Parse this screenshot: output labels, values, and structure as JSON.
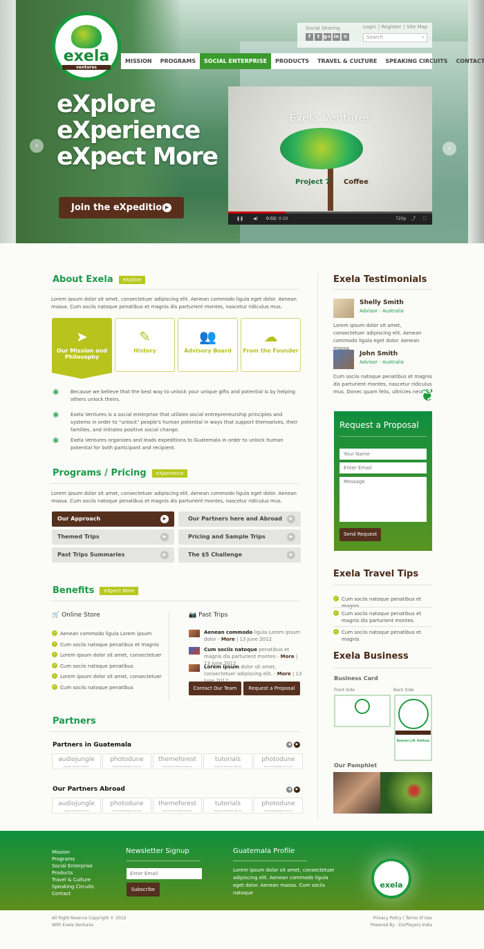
{
  "header": {
    "logo_text": "exela",
    "logo_sub": "ventures",
    "logo_ring": "EXPLORE • EXPERIENCE • EXPECT MORE • JOIN THE EXPEDITION",
    "social_label": "Social Sharing",
    "social_icons": [
      "facebook-icon",
      "twitter-icon",
      "google-plus-icon",
      "linkedin-icon",
      "rss-icon"
    ],
    "social_glyphs": [
      "f",
      "t",
      "g+",
      "in",
      "≋"
    ],
    "top_links": [
      "Login",
      "Register",
      "Site Map"
    ],
    "search_placeholder": "Search",
    "nav": [
      "MISSION",
      "PROGRAMS",
      "SOCIAL ENTERPRISE",
      "PRODUCTS",
      "TRAVEL & CULTURE",
      "SPEAKING CIRCUITS",
      "CONTACT"
    ],
    "nav_active": "SOCIAL ENTERPRISE"
  },
  "hero": {
    "lines": [
      "eXplore",
      "eXperience",
      "eXpect More"
    ],
    "cta": "Join the eXpedition",
    "video": {
      "title": "Exela Ventures",
      "left_text": "Project 7",
      "right_text": "Coffee",
      "time_current": "0:02",
      "time_total": "0:10",
      "quality": "720p",
      "progress_percent": 28
    }
  },
  "about": {
    "title": "About Exela",
    "tag": "eXplore",
    "intro": "Lorem ipsum dolor sit amet, consectetuer adipiscing elit. Aenean commodo ligula eget dolor. Aenean massa. Cum sociis natoque penatibus et magnis dis parturient montes, nascetur ridiculus mus.",
    "tiles": [
      {
        "label": "Our Mission and Philosophy",
        "icon": "paper-plane-icon",
        "glyph": "➤"
      },
      {
        "label": "History",
        "icon": "edit-icon",
        "glyph": "✎"
      },
      {
        "label": "Advisory Board",
        "icon": "users-icon",
        "glyph": "👥"
      },
      {
        "label": "From the Founder",
        "icon": "cloud-icon",
        "glyph": "☁"
      }
    ],
    "bullets": [
      "Because we believe that the best way to unlock your unique gifts and potential is by helping others unlock theirs.",
      "Exela Ventures is a social enterprise that utilizes social entrepreneurship principles and systems in order to \"unlock\" people's human potential in ways that support themselves, their families, and initiates positive social change.",
      "Exela Ventures organizes and leads expeditions to Guatemala in order to unlock human potential for both participant and recipient."
    ]
  },
  "programs": {
    "title": "Programs / Pricing",
    "tag": "eXperience",
    "intro": "Lorem ipsum dolor sit amet, consectetuer adipiscing elit. Aenean commodo ligula eget dolor. Aenean massa. Cum sociis natoque penatibus et magnis dis parturient montes, nascetur ridiculus mus.",
    "buttons": [
      "Our Approach",
      "Our Partners here and Abroad",
      "Themed Trips",
      "Pricing and Sample Trips",
      "Past Trips Summaries",
      "The $5 Challenge"
    ]
  },
  "benefits": {
    "title": "Benefits",
    "tag": "eXpect More",
    "store_title": "Online Store",
    "store_items": [
      "Aenean commodo ligula Lorem ipsum",
      "Cum sociis natoque penatibus et magnis",
      "Lorem ipsum dolor sit amet, consectetuer",
      "Cum sociis natoque penatibus",
      "Lorem ipsum dolor sit amet, consectetuer",
      "Cum sociis natoque penatibus"
    ],
    "trips_title": "Past Trips",
    "trips": [
      {
        "bold": "Aenean commodo",
        "text": " ligula Lorem ipsum dolor - ",
        "more": "More",
        "date": " | 13 June 2012"
      },
      {
        "bold": "Cum sociis natoque",
        "text": " penatibus et magnis dis parturient montes - ",
        "more": "More",
        "date": " | 13 June 2012"
      },
      {
        "bold": "Lorem ipsum",
        "text": " dolor sit amet, consectetuer adipiscing elit.  - ",
        "more": "More",
        "date": " | 13 June 2012"
      }
    ],
    "contact_btn": "Contact Our Team",
    "proposal_btn": "Request a Proposal"
  },
  "partners": {
    "title": "Partners",
    "groups": [
      {
        "title": "Partners in Guatemala"
      },
      {
        "title": "Our Partners Abroad"
      }
    ],
    "logos": [
      {
        "name": "audiojungle",
        "sub": "Royalty Free Stock Music"
      },
      {
        "name": "photodune",
        "sub": "Stock Photography From $1"
      },
      {
        "name": "themeforest",
        "sub": "Premium WordPress Themes"
      },
      {
        "name": "tutorials",
        "sub": "Premium Tutorials, eBooks"
      },
      {
        "name": "photodune",
        "sub": "Stock Photography From $1"
      }
    ]
  },
  "testimonials": {
    "title": "Exela Testimonials",
    "items": [
      {
        "name": "Shelly Smith",
        "role": "Advisor - Australia",
        "text": "Lorem ipsum dolor sit amet, consectetuer adipiscing elit. Aenean commodo ligula eget dolor. Aenean massa."
      },
      {
        "name": "John Smith",
        "role": "Advisor - Australia",
        "text": "Cum sociis natoque penatibus et magnis dis parturient montes, nascetur ridiculus mus. Donec quam felis, ultricies nec"
      }
    ]
  },
  "proposal": {
    "title": "Request a Proposal",
    "name_placeholder": "Your Name",
    "email_placeholder": "Enter Email",
    "message_placeholder": "Message",
    "submit": "Send Request"
  },
  "travel_tips": {
    "title": "Exela Travel Tips",
    "items": [
      "Cum sociis natoque penatibus et magnis",
      "Cum sociis natoque penatibus et magnis dis parturient montes.",
      "Cum sociis natoque penatibus et magnis"
    ]
  },
  "business": {
    "title": "Exela Business",
    "card_title": "Business Card",
    "front": "Front Side",
    "back": "Back Side",
    "back_name": "Demetri J.M. Patitsas",
    "pamphlet": "Our Pamphlet"
  },
  "footer": {
    "links": [
      "Mission",
      "Programs",
      "Social Enterprise",
      "Products",
      "Travel & Culture",
      "Speaking Circuits",
      "Contact"
    ],
    "newsletter_title": "Newsletter Signup",
    "newsletter_placeholder": "Enter Email",
    "subscribe": "Subscribe",
    "profile_title": "Guatemala Profile",
    "profile_text": "Lorem ipsum dolor sit amet, consectetuer adipiscing elit. Aenean commodo ligula eget dolor. Aenean massa. Cum sociis natoque",
    "copyright1": "All Right Reserve Copyright © 2012",
    "copyright2": "With Exela Ventures",
    "privacy": "Privacy Policy",
    "terms": "Terms of Use",
    "powered": "Powered By : DivPlayers India"
  }
}
